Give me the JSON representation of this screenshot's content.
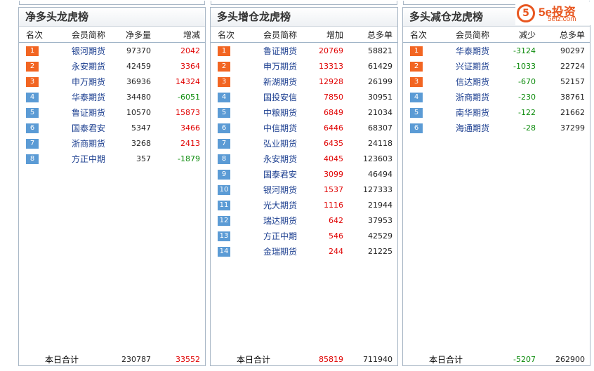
{
  "panels": [
    {
      "title": "净多头龙虎榜",
      "headers": [
        "名次",
        "会员简称",
        "净多量",
        "增减"
      ],
      "rank_style": "mixed",
      "rows": [
        {
          "rank": "1",
          "name": "银河期货",
          "a": "97370",
          "b": "2042",
          "b_color": "red"
        },
        {
          "rank": "2",
          "name": "永安期货",
          "a": "42459",
          "b": "3364",
          "b_color": "red"
        },
        {
          "rank": "3",
          "name": "申万期货",
          "a": "36936",
          "b": "14324",
          "b_color": "red"
        },
        {
          "rank": "4",
          "name": "华泰期货",
          "a": "34480",
          "b": "-6051",
          "b_color": "green"
        },
        {
          "rank": "5",
          "name": "鲁证期货",
          "a": "10570",
          "b": "15873",
          "b_color": "red"
        },
        {
          "rank": "6",
          "name": "国泰君安",
          "a": "5347",
          "b": "3466",
          "b_color": "red"
        },
        {
          "rank": "7",
          "name": "浙商期货",
          "a": "3268",
          "b": "2413",
          "b_color": "red"
        },
        {
          "rank": "8",
          "name": "方正中期",
          "a": "357",
          "b": "-1879",
          "b_color": "green"
        }
      ],
      "footer": {
        "label": "本日合计",
        "a": "230787",
        "b": "33552",
        "b_color": "red"
      }
    },
    {
      "title": "多头增仓龙虎榜",
      "headers": [
        "名次",
        "会员简称",
        "增加",
        "总多单"
      ],
      "rank_style": "mixed",
      "rows": [
        {
          "rank": "1",
          "name": "鲁证期货",
          "a": "20769",
          "b": "58821",
          "a_color": "red"
        },
        {
          "rank": "2",
          "name": "申万期货",
          "a": "13313",
          "b": "61429",
          "a_color": "red"
        },
        {
          "rank": "3",
          "name": "新湖期货",
          "a": "12928",
          "b": "26199",
          "a_color": "red"
        },
        {
          "rank": "4",
          "name": "国投安信",
          "a": "7850",
          "b": "30951",
          "a_color": "red"
        },
        {
          "rank": "5",
          "name": "中粮期货",
          "a": "6849",
          "b": "21034",
          "a_color": "red"
        },
        {
          "rank": "6",
          "name": "中信期货",
          "a": "6446",
          "b": "68307",
          "a_color": "red"
        },
        {
          "rank": "7",
          "name": "弘业期货",
          "a": "6435",
          "b": "24118",
          "a_color": "red"
        },
        {
          "rank": "8",
          "name": "永安期货",
          "a": "4045",
          "b": "123603",
          "a_color": "red"
        },
        {
          "rank": "9",
          "name": "国泰君安",
          "a": "3099",
          "b": "46494",
          "a_color": "red"
        },
        {
          "rank": "10",
          "name": "银河期货",
          "a": "1537",
          "b": "127333",
          "a_color": "red"
        },
        {
          "rank": "11",
          "name": "光大期货",
          "a": "1116",
          "b": "21944",
          "a_color": "red"
        },
        {
          "rank": "12",
          "name": "瑞达期货",
          "a": "642",
          "b": "37953",
          "a_color": "red"
        },
        {
          "rank": "13",
          "name": "方正中期",
          "a": "546",
          "b": "42529",
          "a_color": "red"
        },
        {
          "rank": "14",
          "name": "金瑞期货",
          "a": "244",
          "b": "21225",
          "a_color": "red"
        }
      ],
      "footer": {
        "label": "本日合计",
        "a": "85819",
        "b": "711940",
        "a_color": "red"
      }
    },
    {
      "title": "多头减仓龙虎榜",
      "headers": [
        "名次",
        "会员简称",
        "减少",
        "总多单"
      ],
      "rank_style": "mixed",
      "rows": [
        {
          "rank": "1",
          "name": "华泰期货",
          "a": "-3124",
          "b": "90297",
          "a_color": "green"
        },
        {
          "rank": "2",
          "name": "兴证期货",
          "a": "-1033",
          "b": "22724",
          "a_color": "green"
        },
        {
          "rank": "3",
          "name": "信达期货",
          "a": "-670",
          "b": "52157",
          "a_color": "green"
        },
        {
          "rank": "4",
          "name": "浙商期货",
          "a": "-230",
          "b": "38761",
          "a_color": "green"
        },
        {
          "rank": "5",
          "name": "南华期货",
          "a": "-122",
          "b": "21662",
          "a_color": "green"
        },
        {
          "rank": "6",
          "name": "海通期货",
          "a": "-28",
          "b": "37299",
          "a_color": "green"
        }
      ],
      "footer": {
        "label": "本日合计",
        "a": "-5207",
        "b": "262900",
        "a_color": "green"
      }
    }
  ],
  "logo": {
    "brand": "5e投资",
    "site": "5etz.com",
    "symbol": "5"
  },
  "colors": {
    "hot_rank": "#f26522",
    "cold_rank": "#5b9bd5",
    "up": "#e00000",
    "down": "#0a8a0a",
    "name": "#1a3d8f"
  }
}
